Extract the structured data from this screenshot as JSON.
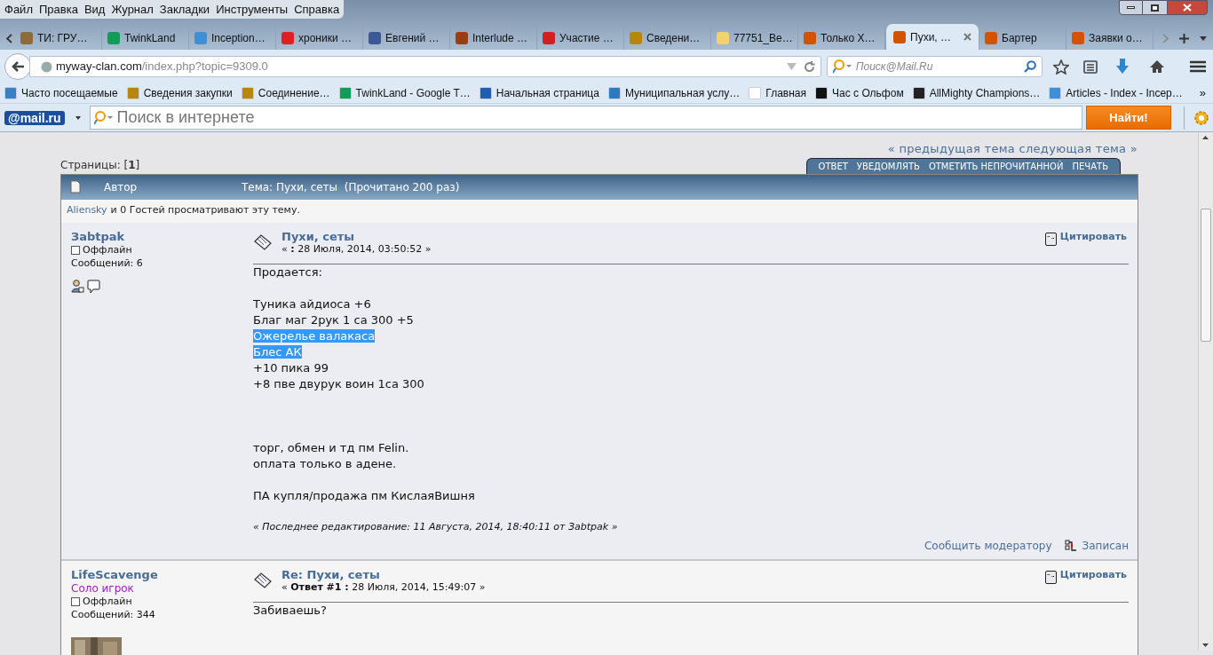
{
  "menu": [
    "Файл",
    "Правка",
    "Вид",
    "Журнал",
    "Закладки",
    "Инструменты",
    "Справка"
  ],
  "tabs": [
    {
      "title": "ТИ: ГРУ…",
      "color": "#8a6d3b",
      "selected": false
    },
    {
      "title": "TwinkLand",
      "color": "#0f9d58",
      "selected": false
    },
    {
      "title": "Inception…",
      "color": "#3d8fd6",
      "selected": false
    },
    {
      "title": "хроники …",
      "color": "#e02020",
      "selected": false
    },
    {
      "title": "Евгений …",
      "color": "#3b5998",
      "selected": false
    },
    {
      "title": "Interlude …",
      "color": "#9a3d10",
      "selected": false
    },
    {
      "title": "Участие …",
      "color": "#d02020",
      "selected": false
    },
    {
      "title": "Сведени…",
      "color": "#b8860b",
      "selected": false
    },
    {
      "title": "77751_Ве…",
      "color": "#f2d36b",
      "selected": false
    },
    {
      "title": "Только Х…",
      "color": "#d35400",
      "selected": false
    },
    {
      "title": "Пухи, …",
      "color": "#d35400",
      "selected": true
    },
    {
      "title": "Бартер",
      "color": "#d35400",
      "selected": false
    },
    {
      "title": "Заявки о…",
      "color": "#d35400",
      "selected": false
    }
  ],
  "address": {
    "domain": "myway-clan.com",
    "path": "/index.php?topic=9309.0"
  },
  "web_search": {
    "placeholder": "Поиск@Mail.Ru"
  },
  "bookmarks": [
    {
      "title": "Часто посещаемые",
      "color": "#3d7fc4"
    },
    {
      "title": "Сведения закупки",
      "color": "#b8860b"
    },
    {
      "title": "Соединение…",
      "color": "#b8860b"
    },
    {
      "title": "TwinkLand - Google T…",
      "color": "#0f9d58"
    },
    {
      "title": "Начальная страница",
      "color": "#1e5fb4"
    },
    {
      "title": "Муниципальная услу…",
      "color": "#2a7bbf"
    },
    {
      "title": "Главная",
      "color": "#ffffff"
    },
    {
      "title": "Час с Ольфом",
      "color": "#111111"
    },
    {
      "title": "AllMighty Champions…",
      "color": "#222222"
    },
    {
      "title": "Articles - Index - Incep…",
      "color": "#3d8fd6"
    }
  ],
  "bookmarks_more": "»",
  "mailru": {
    "logo": "@mail.ru",
    "placeholder": "Поиск в интернете",
    "button": "Найти!"
  },
  "forum": {
    "topic_nav": "« предыдущая тема следующая тема »",
    "pages_label": "Страницы: [",
    "current_page": "1",
    "pages_end": "]",
    "actions": [
      "ОТВЕТ",
      "УВЕДОМЛЯТЬ",
      "ОТМЕТИТЬ НЕПРОЧИТАННОЙ",
      "ПЕЧАТЬ"
    ],
    "header": {
      "author": "Автор",
      "topic": "Тема: Пухи, сеты  (Прочитано 200 раз)"
    },
    "viewers": {
      "user": "Aliensky",
      "text": "и 0 Гостей просматривают эту тему."
    },
    "posts": [
      {
        "author": "Зabtpak",
        "status": "Оффлайн",
        "post_count": "Сообщений: 6",
        "profile_icons": true,
        "title": "Пухи, сеты",
        "date": "« **:** 28 Июля, 2014, 03:50:52 »",
        "quote": "Цитировать",
        "body": [
          {
            "kind": "normal",
            "lines": [
              {
                "text": "Продается:",
                "highlighted": false
              }
            ]
          },
          {
            "kind": "normal",
            "lines": [
              {
                "text": "Туника айдиоса +6",
                "highlighted": false
              },
              {
                "text": "Благ маг 2рук 1 са 300 +5",
                "highlighted": false
              },
              {
                "text": "Ожерелье валакаса",
                "highlighted": true
              },
              {
                "text": "Блес АК",
                "highlighted": true
              },
              {
                "text": "+10 пика 99",
                "highlighted": false
              },
              {
                "text": "+8 пве двурук воин 1са 300",
                "highlighted": false
              }
            ]
          },
          {
            "kind": "wide",
            "lines": [
              {
                "text": "торг, обмен и тд пм Felin.",
                "highlighted": false
              },
              {
                "text": "оплата только в адене.",
                "highlighted": false
              }
            ]
          },
          {
            "kind": "normal",
            "lines": [
              {
                "text": "ПА купля/продажа пм КислаяВишня",
                "highlighted": false
              }
            ]
          }
        ],
        "edited": "« Последнее редактирование: 11 Августа, 2014, 18:40:11 от Зabtpak »",
        "report": "Сообщить модератору",
        "logged": "Записан"
      },
      {
        "author": "LifeScavenge",
        "rank": "Соло игрок",
        "status": "Оффлайн",
        "post_count": "Сообщений: 344",
        "avatar": {
          "kind": "picture"
        },
        "title": "Re: Пухи, сеты",
        "date": "« **Ответ #1 :** 28 Июля, 2014, 15:49:07 »",
        "quote": "Цитировать",
        "body": [
          {
            "kind": "normal",
            "lines": [
              {
                "text": "Забиваешь?",
                "highlighted": false
              }
            ]
          }
        ]
      }
    ]
  }
}
